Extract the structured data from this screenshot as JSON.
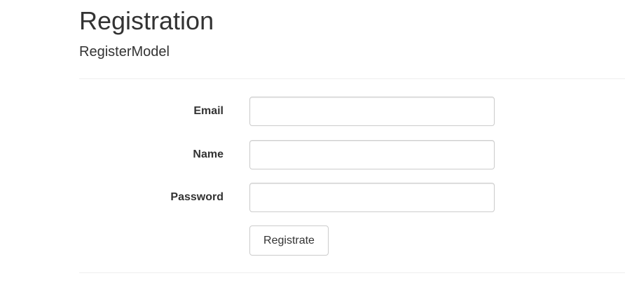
{
  "header": {
    "title": "Registration",
    "subtitle": "RegisterModel"
  },
  "form": {
    "fields": [
      {
        "label": "Email",
        "value": "",
        "placeholder": ""
      },
      {
        "label": "Name",
        "value": "",
        "placeholder": ""
      },
      {
        "label": "Password",
        "value": "",
        "placeholder": ""
      }
    ],
    "submit_label": "Registrate"
  }
}
